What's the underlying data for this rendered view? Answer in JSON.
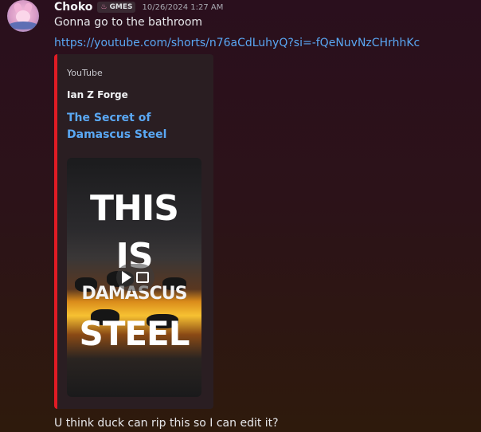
{
  "message": {
    "username": "Choko",
    "tag": {
      "icon": "flame-icon",
      "label": "GMES"
    },
    "timestamp": "10/26/2024 1:27 AM",
    "text": "Gonna go to the bathroom",
    "link": "https://youtube.com/shorts/n76aCdLuhyQ?si=-fQeNuvNzCHrhhKc"
  },
  "embed": {
    "provider": "YouTube",
    "author": "Ian Z Forge",
    "title": "The Secret of Damascus Steel",
    "accent_color": "#e01b24",
    "thumbnail": {
      "line1": "THIS",
      "line2": "IS",
      "line3": "DAMASCUS",
      "line4": "STEEL"
    }
  },
  "followup": {
    "text": "U think duck can rip this so I can edit it?"
  }
}
